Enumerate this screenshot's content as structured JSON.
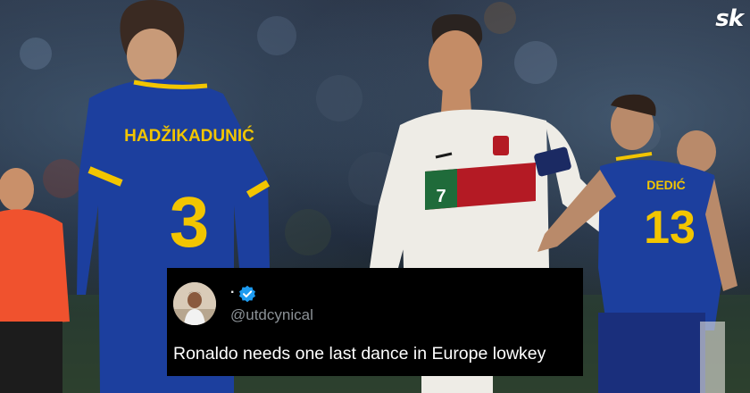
{
  "brand": {
    "logo_text": "sk"
  },
  "players": {
    "left_name": "HADŽIKADUNIĆ",
    "left_number": "3",
    "right_name": "DEDIĆ",
    "right_number": "13",
    "center_number": "7"
  },
  "tweet": {
    "display_name": ".",
    "handle": "@utdcynical",
    "text": "Ronaldo needs one last dance in Europe lowkey",
    "verified_badge_color": "#1d9bf0"
  },
  "colors": {
    "bosnia_kit": "#1c3f9e",
    "bosnia_trim": "#f2c500",
    "portugal_red": "#b41a24",
    "portugal_green": "#1f6b3a",
    "tweet_background": "#000000"
  }
}
